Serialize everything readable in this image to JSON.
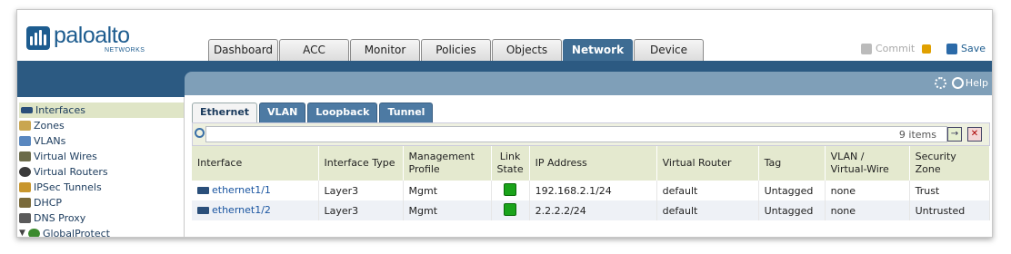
{
  "brand": {
    "name": "paloalto",
    "tagline": "NETWORKS"
  },
  "top_tabs": [
    {
      "label": "Dashboard",
      "active": false
    },
    {
      "label": "ACC",
      "active": false
    },
    {
      "label": "Monitor",
      "active": false
    },
    {
      "label": "Policies",
      "active": false
    },
    {
      "label": "Objects",
      "active": false
    },
    {
      "label": "Network",
      "active": true
    },
    {
      "label": "Device",
      "active": false
    }
  ],
  "header_actions": {
    "commit_label": "Commit",
    "save_label": "Save",
    "help_label": "Help"
  },
  "sidebar": {
    "items": [
      {
        "label": "Interfaces",
        "icon": "ethernet-icon",
        "active": true
      },
      {
        "label": "Zones",
        "icon": "zones-icon",
        "active": false
      },
      {
        "label": "VLANs",
        "icon": "vlan-icon",
        "active": false
      },
      {
        "label": "Virtual Wires",
        "icon": "virtual-wire-icon",
        "active": false
      },
      {
        "label": "Virtual Routers",
        "icon": "router-icon",
        "active": false
      },
      {
        "label": "IPSec Tunnels",
        "icon": "tunnel-icon",
        "active": false
      },
      {
        "label": "DHCP",
        "icon": "dhcp-icon",
        "active": false
      },
      {
        "label": "DNS Proxy",
        "icon": "dns-icon",
        "active": false
      },
      {
        "label": "GlobalProtect",
        "icon": "globe-icon",
        "active": false,
        "expanded": true
      }
    ]
  },
  "sub_tabs": [
    {
      "label": "Ethernet",
      "active": true
    },
    {
      "label": "VLAN",
      "active": false
    },
    {
      "label": "Loopback",
      "active": false
    },
    {
      "label": "Tunnel",
      "active": false
    }
  ],
  "filter": {
    "value": "",
    "items_count": "9 items"
  },
  "table": {
    "columns": [
      "Interface",
      "Interface Type",
      "Management Profile",
      "Link State",
      "IP Address",
      "Virtual Router",
      "Tag",
      "VLAN / Virtual-Wire",
      "Security Zone"
    ],
    "rows": [
      {
        "interface": "ethernet1/1",
        "type": "Layer3",
        "mgmt_profile": "Mgmt",
        "link_state": "up",
        "ip": "192.168.2.1/24",
        "vrouter": "default",
        "tag": "Untagged",
        "vlan": "none",
        "zone": "Trust"
      },
      {
        "interface": "ethernet1/2",
        "type": "Layer3",
        "mgmt_profile": "Mgmt",
        "link_state": "up",
        "ip": "2.2.2.2/24",
        "vrouter": "default",
        "tag": "Untagged",
        "vlan": "none",
        "zone": "Untrusted"
      }
    ]
  },
  "colors": {
    "brand_blue": "#1d5c8f",
    "active_tab": "#3e6c93",
    "bar_blue": "#2c5a82",
    "link_up": "#1aa31a"
  }
}
